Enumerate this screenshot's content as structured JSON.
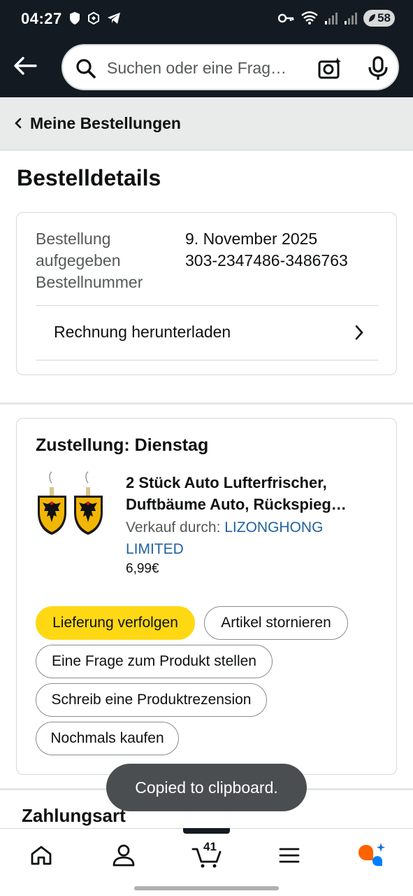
{
  "status_bar": {
    "time": "04:27",
    "battery": "58"
  },
  "search": {
    "placeholder": "Suchen oder eine Frag…"
  },
  "breadcrumb": {
    "label": "Meine Bestellungen"
  },
  "page": {
    "title": "Bestelldetails"
  },
  "order_info": {
    "placed_label_line1": "Bestellung",
    "placed_label_line2": "aufgegeben",
    "number_label": "Bestellnummer",
    "date": "9. November 2025",
    "number": "303-2347486-3486763",
    "invoice_link": "Rechnung herunterladen"
  },
  "shipment": {
    "title": "Zustellung: Dienstag",
    "product_title_line1": "2 Stück Auto Lufterfrischer,",
    "product_title_line2": "Duftbäume Auto, Rückspieg…",
    "seller_prefix": "Verkauf durch: ",
    "seller_name_line1": "LIZONGHONG",
    "seller_name_line2": "LIMITED",
    "price": "6,99€",
    "buttons": {
      "track": "Lieferung verfolgen",
      "cancel": "Artikel stornieren",
      "question": "Eine Frage zum Produkt stellen",
      "review": "Schreib eine Produktrezension",
      "buy_again": "Nochmals kaufen"
    }
  },
  "payment": {
    "title": "Zahlungsart"
  },
  "toast": {
    "message": "Copied to clipboard."
  },
  "bottom_nav": {
    "cart_count": "41",
    "items": [
      "home-icon",
      "account-icon",
      "cart-icon",
      "menu-icon",
      "rufus-icon"
    ]
  },
  "colors": {
    "header_bg": "#131a22",
    "primary_button": "#ffd814",
    "link": "#2162a1",
    "toast_bg": "#4a4e50"
  }
}
